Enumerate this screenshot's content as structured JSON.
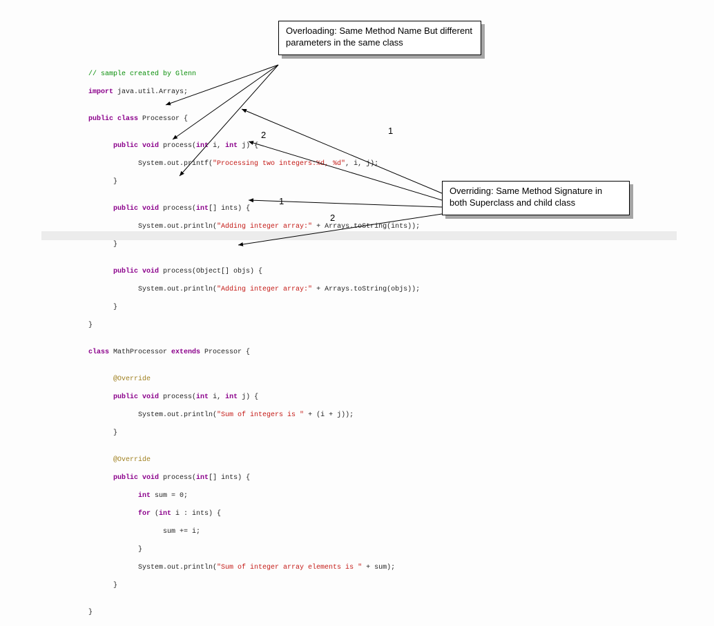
{
  "callouts": {
    "overloading": "Overloading: Same Method Name But different parameters in the same class",
    "overriding": "Overriding: Same Method Signature in both Superclass and child class"
  },
  "labels": {
    "num1_top": "1",
    "num2_top": "2",
    "num1_mid": "1",
    "num2_mid": "2"
  },
  "code": {
    "l01": "// sample created by Glenn",
    "l02a": "import",
    "l02b": " java.util.Arrays;",
    "l03": "",
    "l04a": "public class",
    "l04b": " Processor {",
    "l05": "",
    "l06a": "      public void",
    "l06b": " process(",
    "l06c": "int",
    "l06d": " i, ",
    "l06e": "int",
    "l06f": " j) {",
    "l07a": "            System.out.printf(",
    "l07b": "\"Processing two integers:%d, %d\"",
    "l07c": ", i, j);",
    "l08": "      }",
    "l09": "",
    "l10a": "      public void",
    "l10b": " process(",
    "l10c": "int",
    "l10d": "[] ints) {",
    "l11a": "            System.out.println(",
    "l11b": "\"Adding integer array:\"",
    "l11c": " + Arrays.toString(ints));",
    "l12": "      }",
    "l13": "",
    "l14a": "      public void",
    "l14b": " process(Object[] objs) {",
    "l15a": "            System.out.println(",
    "l15b": "\"Adding integer array:\"",
    "l15c": " + Arrays.toString(objs));",
    "l16": "      }",
    "l17": "}",
    "l18": "",
    "l19a": "class",
    "l19b": " MathProcessor ",
    "l19c": "extends",
    "l19d": " Processor {",
    "l20": "",
    "l21": "      @Override",
    "l22a": "      public void",
    "l22b": " process(",
    "l22c": "int",
    "l22d": " i, ",
    "l22e": "int",
    "l22f": " j) {",
    "l23a": "            System.out.println(",
    "l23b": "\"Sum of integers is \"",
    "l23c": " + (i + j));",
    "l24": "      }",
    "l25": "",
    "l26": "      @Override",
    "l27a": "      public void",
    "l27b": " process(",
    "l27c": "int",
    "l27d": "[] ints) {",
    "l28a": "            int",
    "l28b": " sum = 0;",
    "l29a": "            for",
    "l29b": " (",
    "l29c": "int",
    "l29d": " i : ints) {",
    "l30": "                  sum += i;",
    "l31": "            }",
    "l32a": "            System.out.println(",
    "l32b": "\"Sum of integer array elements is \"",
    "l32c": " + sum);",
    "l33": "      }",
    "l34": "",
    "l35": "}"
  }
}
